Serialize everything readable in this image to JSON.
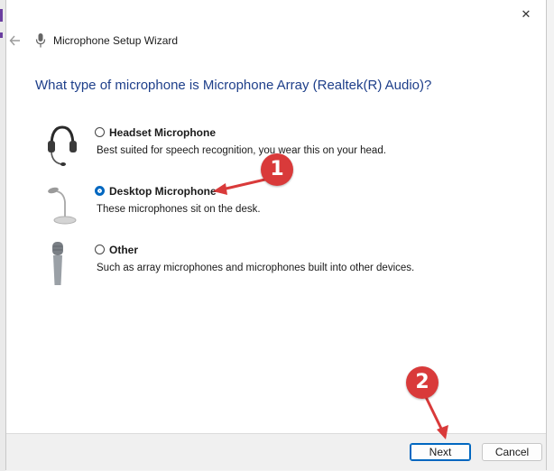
{
  "window": {
    "title": "Microphone Setup Wizard",
    "close_glyph": "✕"
  },
  "question": "What type of microphone is Microphone Array (Realtek(R) Audio)?",
  "options": [
    {
      "label": "Headset Microphone",
      "description": "Best suited for speech recognition, you wear this on your head.",
      "selected": false,
      "icon": "headset-icon"
    },
    {
      "label": "Desktop Microphone",
      "description": "These microphones sit on the desk.",
      "selected": true,
      "icon": "desktop-microphone-icon"
    },
    {
      "label": "Other",
      "description": "Such as array microphones and microphones built into other devices.",
      "selected": false,
      "icon": "handheld-microphone-icon"
    }
  ],
  "buttons": {
    "next_label": "Next",
    "cancel_label": "Cancel"
  },
  "annotations": [
    {
      "number": "1"
    },
    {
      "number": "2"
    }
  ],
  "colors": {
    "accent": "#0067c0",
    "question_text": "#1e3f8a",
    "annotation_red": "#d93a3a"
  }
}
